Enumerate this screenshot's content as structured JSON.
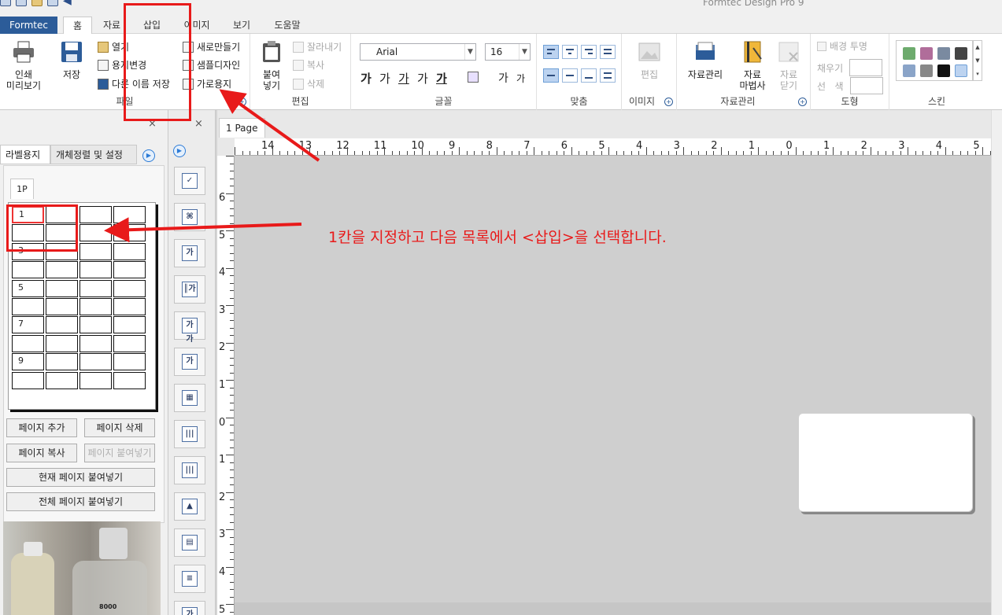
{
  "app": {
    "title": "Formtec Design Pro 9"
  },
  "tabs": {
    "file": "Formtec",
    "items": [
      "홈",
      "자료",
      "삽입",
      "이미지",
      "보기",
      "도움말"
    ]
  },
  "ribbon": {
    "print_preview": "인쇄\n미리보기",
    "save": "저장",
    "open": "열기",
    "change_paper": "용지변경",
    "save_as": "다른 이름 저장",
    "new": "새로만들기",
    "sample_design": "샘플디자인",
    "landscape": "가로용지",
    "group_file": "파일",
    "paste": "붙여\n넣기",
    "cut": "잘라내기",
    "copy": "복사",
    "delete": "삭제",
    "group_edit": "편집",
    "font_name": "Arial",
    "font_size": "16",
    "group_font": "글꼴",
    "group_align": "맞춤",
    "image_edit": "편집",
    "group_image": "이미지",
    "data_manage": "자료관리",
    "data_wizard": "자료\n마법사",
    "data_close": "자료\n닫기",
    "group_data": "자료관리",
    "bg_transparent": "배경 투명",
    "fill": "채우기",
    "line_color": "선   색",
    "group_shape": "도형",
    "group_skin": "스킨",
    "fmt_buttons": [
      "가",
      "가",
      "가",
      "가",
      "가",
      "가",
      "가"
    ]
  },
  "left_panel": {
    "tab_label_paper": "라벨용지",
    "tab_object": "개체정렬 및 설정",
    "sheet_tab": "1P",
    "cell_numbers": [
      "1",
      "",
      "",
      "",
      "",
      "",
      "",
      "",
      "3",
      "",
      "",
      "",
      "",
      "",
      "",
      "",
      "5",
      "",
      "",
      "",
      "",
      "",
      "",
      "",
      "7",
      "",
      "",
      "",
      "",
      "",
      "",
      "",
      "9",
      "",
      "",
      "",
      "",
      "",
      "",
      ""
    ],
    "add_page": "페이지 추가",
    "delete_page": "페이지 삭제",
    "copy_page": "페이지 복사",
    "paste_page": "페이지 붙여넣기",
    "paste_current": "현재 페이지 붙여넣기",
    "paste_all": "전체 페이지 붙여넣기",
    "photo_text": "8000"
  },
  "canvas": {
    "page_tab": "1 Page",
    "hruler_labels": [
      "14",
      "13",
      "12",
      "11",
      "10",
      "9",
      "8",
      "7",
      "6",
      "5",
      "4",
      "3",
      "2",
      "1",
      "0",
      "1",
      "2",
      "3",
      "4",
      "5"
    ],
    "vruler_labels": [
      "6",
      "5",
      "4",
      "3",
      "2",
      "1",
      "0",
      "1",
      "2",
      "3",
      "4",
      "5"
    ],
    "annotation": "1칸을 지정하고 다음 목록에서 <삽입>을 선택합니다."
  },
  "colors": {
    "accent": "#2c5c99",
    "annotation": "#e81a1a"
  }
}
